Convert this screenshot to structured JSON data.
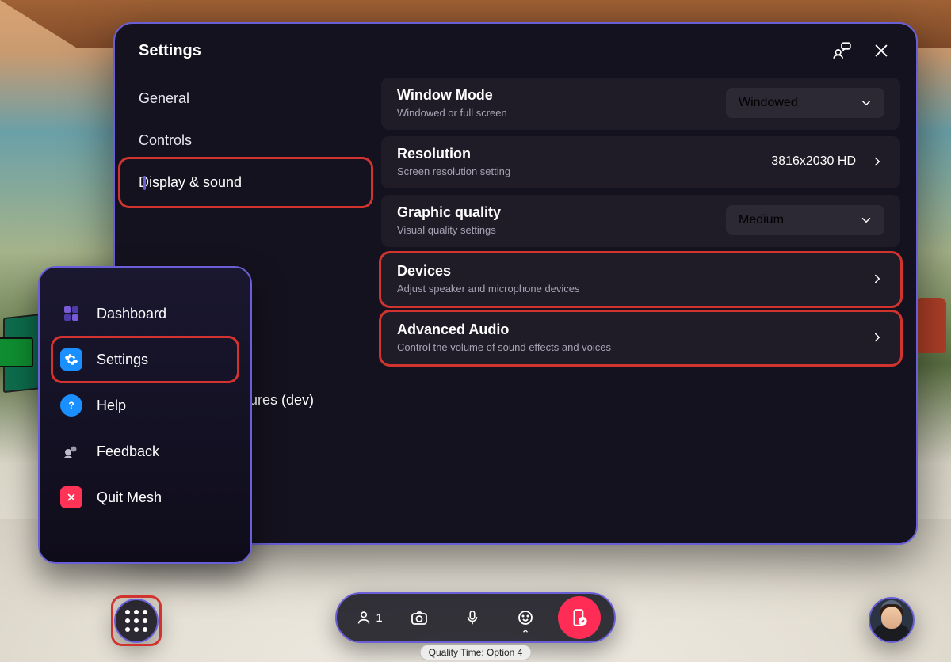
{
  "panel": {
    "title": "Settings",
    "nav": [
      {
        "label": "General"
      },
      {
        "label": "Controls"
      },
      {
        "label": "Display & sound"
      }
    ],
    "peeked_nav_fragment": "ures (dev)",
    "rows": {
      "window_mode": {
        "label": "Window Mode",
        "sub": "Windowed or full screen",
        "value": "Windowed"
      },
      "resolution": {
        "label": "Resolution",
        "sub": "Screen resolution setting",
        "value": "3816x2030 HD"
      },
      "graphics": {
        "label": "Graphic quality",
        "sub": "Visual quality settings",
        "value": "Medium"
      },
      "devices": {
        "label": "Devices",
        "sub": "Adjust speaker and microphone devices"
      },
      "audio": {
        "label": "Advanced Audio",
        "sub": "Control the volume of sound effects and voices"
      }
    }
  },
  "menu": {
    "items": {
      "dashboard": "Dashboard",
      "settings": "Settings",
      "help": "Help",
      "feedback": "Feedback",
      "quit": "Quit Mesh"
    }
  },
  "bottom": {
    "people_count": "1",
    "quality_chip": "Quality Time: Option 4"
  }
}
